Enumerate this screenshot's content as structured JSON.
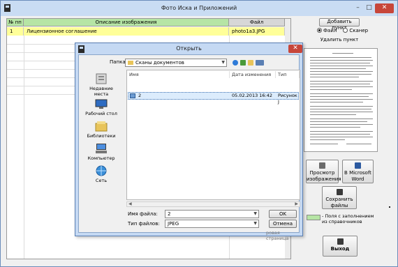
{
  "window": {
    "title": "Фото Иска и Приложений",
    "minimize": "–",
    "maximize": "□",
    "close": "✕"
  },
  "grid": {
    "headers": [
      "№ пп",
      "Описание изображения",
      "Файл"
    ],
    "rows": [
      {
        "num": "1",
        "desc": "Лицензионное соглашение",
        "file": "photo1a3.JPG"
      }
    ]
  },
  "panel": {
    "add_button": "Добавить пункт",
    "radio_file": "Файл",
    "radio_scanner": "Сканер",
    "radio_selected": "file",
    "delete_button": "Удалить пункт",
    "view_button": "Просмотр изображения",
    "word_button": "В Microsoft Word",
    "save_button": "Сохранить файлы",
    "legend": "- Поля с заполнением из справочников",
    "exit_button": "Выход"
  },
  "dialog": {
    "title": "Открыть",
    "close": "✕",
    "folder_label": "Папка:",
    "folder_value": "Сканы документов",
    "places": [
      "Недавние места",
      "Рабочий стол",
      "Библиотеки",
      "Компьютер",
      "Сеть"
    ],
    "columns": [
      "Имя",
      "Дата изменения",
      "Тип"
    ],
    "files": [
      {
        "name": "2",
        "date": "05.02.2013 16:42",
        "type": "Рисунок J"
      }
    ],
    "filename_label": "Имя файла:",
    "filename_value": "2",
    "filetype_label": "Тип файлов:",
    "filetype_value": "JPEG",
    "ok_button": "OK",
    "cancel_button": "Отмена",
    "behind_text": "ровая страница"
  },
  "colors": {
    "header_green": "#b6e5a5",
    "row_yellow": "#ffff99",
    "titlebar": "#c9dcf3",
    "close_red": "#c7463a"
  }
}
